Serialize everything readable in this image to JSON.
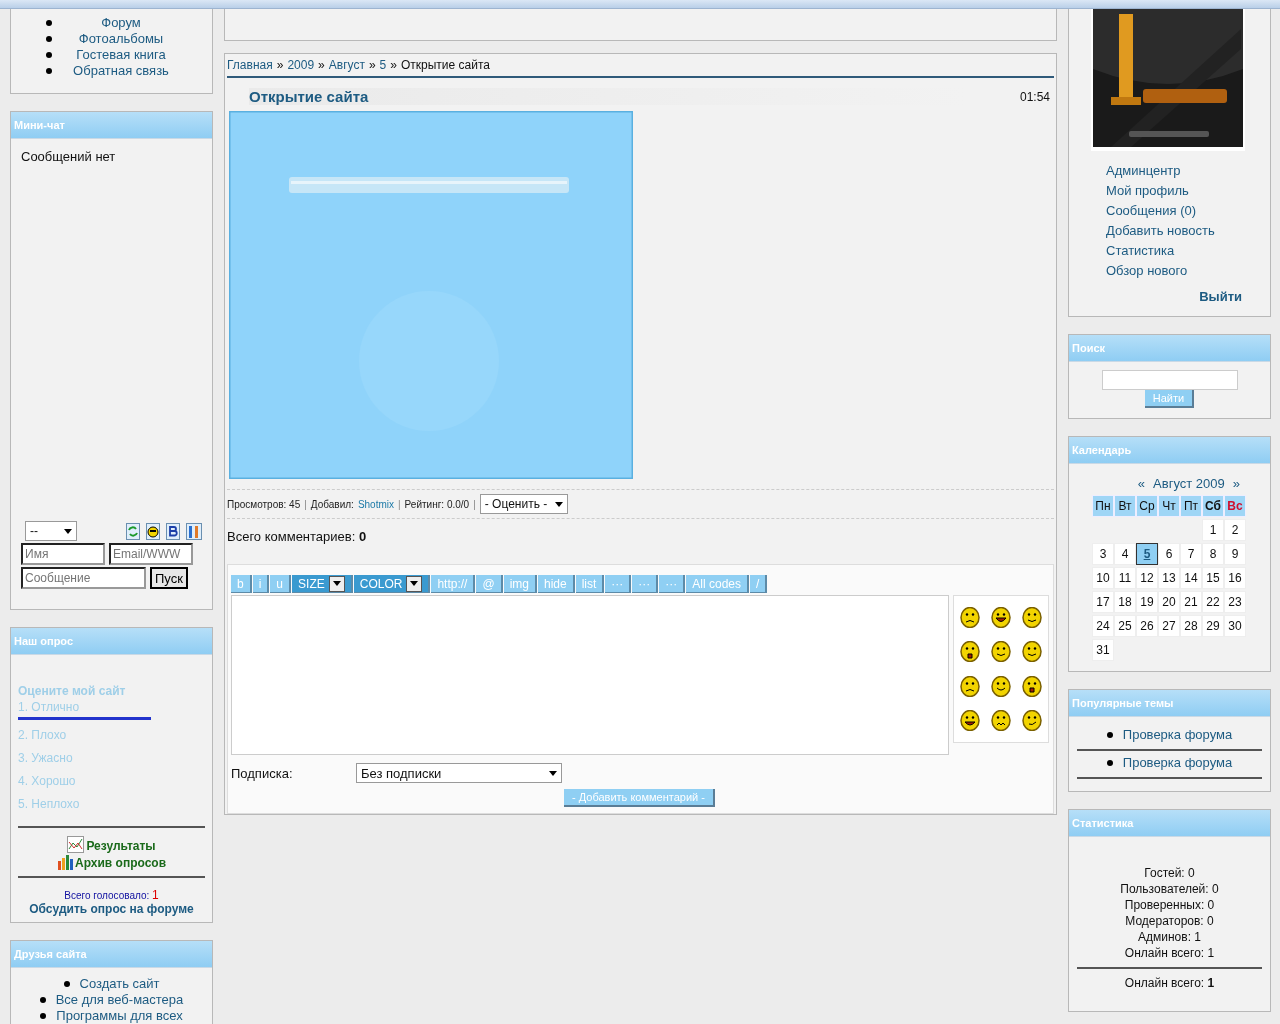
{
  "left": {
    "menu": [
      "Форум",
      "Фотоальбомы",
      "Гостевая книга",
      "Обратная связь"
    ],
    "minichat": {
      "title": "Мини-чат",
      "empty": "Сообщений нет",
      "select": "--",
      "name_placeholder": "Имя",
      "email_placeholder": "Email/WWW",
      "message_placeholder": "Сообщение",
      "send": "Пуск"
    },
    "poll": {
      "title": "Наш опрос",
      "question": "Оцените мой сайт",
      "options": [
        {
          "label": "1. Отлично",
          "level": 0.7
        },
        {
          "label": "2. Плохо"
        },
        {
          "label": "3. Ужасно"
        },
        {
          "label": "4. Хорошо"
        },
        {
          "label": "5. Неплохо"
        }
      ],
      "results": "Результаты",
      "archive": "Архив опросов",
      "total": "Всего голосовало: ",
      "total_count": "1",
      "discuss": "Обсудить опрос на форуме"
    },
    "friends": {
      "title": "Друзья сайта",
      "items": [
        "Создать сайт",
        "Все для веб-мастера",
        "Программы для всех"
      ]
    }
  },
  "center": {
    "breadcrumbs": [
      {
        "kind": "link",
        "label": "Главная"
      },
      {
        "kind": "sep",
        "label": "»"
      },
      {
        "kind": "link",
        "label": "2009"
      },
      {
        "kind": "sep",
        "label": "»"
      },
      {
        "kind": "link",
        "label": "Август"
      },
      {
        "kind": "sep",
        "label": "»"
      },
      {
        "kind": "link",
        "label": "5"
      },
      {
        "kind": "sep",
        "label": "»"
      },
      {
        "kind": "current",
        "label": "Открытие сайта"
      }
    ],
    "title": "Открытие сайта",
    "time": "01:54",
    "meta": [
      {
        "kind": "text",
        "label": "Просмотров: 45"
      },
      {
        "kind": "sep",
        "label": "|"
      },
      {
        "kind": "text",
        "label": "Добавил:"
      },
      {
        "kind": "link",
        "label": "Shotmix"
      },
      {
        "kind": "sep",
        "label": "|"
      },
      {
        "kind": "text",
        "label": "Рейтинг: 0.0/0"
      },
      {
        "kind": "sep",
        "label": "|"
      }
    ],
    "rate_select": "- Оценить -",
    "comments_total": "Всего комментариев: **0**",
    "toolbar": [
      {
        "kind": "button",
        "label": "b"
      },
      {
        "kind": "button",
        "label": "i"
      },
      {
        "kind": "button",
        "label": "u"
      },
      {
        "kind": "dropdown",
        "label": "SIZE"
      },
      {
        "kind": "dropdown",
        "label": "COLOR"
      },
      {
        "kind": "button",
        "label": "http://"
      },
      {
        "kind": "button",
        "label": "@"
      },
      {
        "kind": "button",
        "label": "img"
      },
      {
        "kind": "button",
        "label": "hide"
      },
      {
        "kind": "button",
        "label": "list"
      },
      {
        "kind": "button",
        "label": "···"
      },
      {
        "kind": "button",
        "label": "···"
      },
      {
        "kind": "button",
        "label": "···"
      },
      {
        "kind": "button",
        "label": "All codes"
      },
      {
        "kind": "button",
        "label": "/"
      }
    ],
    "subscription_label": "Подписка:",
    "subscription_value": "Без подписки",
    "submit": "- Добавить комментарий -"
  },
  "right": {
    "links": [
      "Админцентр",
      "Мой профиль",
      "Сообщения (0)",
      "Добавить новость",
      "Статистика",
      "Обзор нового"
    ],
    "logout": "Выйти",
    "search": {
      "title": "Поиск",
      "button": "Найти"
    },
    "calendar": {
      "title": "Календарь",
      "prev": "«",
      "month": "Август 2009",
      "next": "»",
      "weekdays": [
        {
          "kind": "day",
          "label": "Пн"
        },
        {
          "kind": "day",
          "label": "Вт"
        },
        {
          "kind": "day",
          "label": "Ср"
        },
        {
          "kind": "day",
          "label": "Чт"
        },
        {
          "kind": "day",
          "label": "Пт"
        },
        {
          "kind": "sat",
          "label": "Сб"
        },
        {
          "kind": "sun",
          "label": "Вс"
        }
      ],
      "weeks": [
        [
          {
            "label": "1",
            "selected": false
          },
          {
            "label": "2",
            "selected": false
          }
        ],
        [
          {
            "label": "3",
            "selected": false
          },
          {
            "label": "4",
            "selected": false
          },
          {
            "label": "5",
            "selected": true
          },
          {
            "label": "6",
            "selected": false
          },
          {
            "label": "7",
            "selected": false
          },
          {
            "label": "8",
            "selected": false
          },
          {
            "label": "9",
            "selected": false
          }
        ],
        [
          {
            "label": "10",
            "selected": false
          },
          {
            "label": "11",
            "selected": false
          },
          {
            "label": "12",
            "selected": false
          },
          {
            "label": "13",
            "selected": false
          },
          {
            "label": "14",
            "selected": false
          },
          {
            "label": "15",
            "selected": false
          },
          {
            "label": "16",
            "selected": false
          }
        ],
        [
          {
            "label": "17",
            "selected": false
          },
          {
            "label": "18",
            "selected": false
          },
          {
            "label": "19",
            "selected": false
          },
          {
            "label": "20",
            "selected": false
          },
          {
            "label": "21",
            "selected": false
          },
          {
            "label": "22",
            "selected": false
          },
          {
            "label": "23",
            "selected": false
          }
        ],
        [
          {
            "label": "24",
            "selected": false
          },
          {
            "label": "25",
            "selected": false
          },
          {
            "label": "26",
            "selected": false
          },
          {
            "label": "27",
            "selected": false
          },
          {
            "label": "28",
            "selected": false
          },
          {
            "label": "29",
            "selected": false
          },
          {
            "label": "30",
            "selected": false
          }
        ],
        [
          {
            "label": "31",
            "selected": false
          }
        ]
      ]
    },
    "popular": {
      "title": "Популярные темы",
      "items": [
        "Проверка форума",
        "Проверка форума"
      ]
    },
    "stats": {
      "title": "Статистика",
      "lines": [
        "Гостей: 0",
        "Пользователей: 0",
        "Проверенных: 0",
        "Модераторов: 0",
        "Админов: 1",
        "Онлайн всего: 1"
      ],
      "footer": "Онлайн всего: **1**"
    }
  }
}
